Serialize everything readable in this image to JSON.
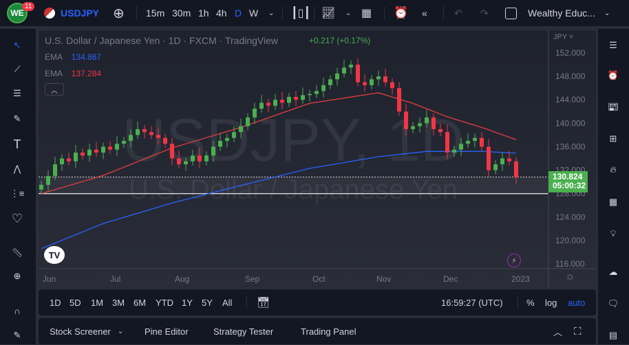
{
  "topbar": {
    "notifications": "11",
    "symbol": "USDJPY",
    "intervals": [
      "15m",
      "30m",
      "1h",
      "4h",
      "D",
      "W"
    ],
    "active_interval": "D",
    "layout_name": "Wealthy Educ..."
  },
  "legend": {
    "title": "U.S. Dollar / Japanese Yen · 1D · FXCM · TradingView",
    "change": "+0.217 (+0.17%)",
    "ema1_label": "EMA",
    "ema1_value": "134.867",
    "ema2_label": "EMA",
    "ema2_value": "137.284"
  },
  "watermark": {
    "line1": "USDJPY, 1D",
    "line2": "U.S. Dollar / Japanese Yen"
  },
  "price_axis": {
    "currency": "JPY",
    "ticks": [
      "152.000",
      "148.000",
      "144.000",
      "140.000",
      "136.000",
      "132.000",
      "128.000",
      "124.000",
      "120.000",
      "116.000"
    ],
    "last_price": "130.824",
    "countdown": "05:00:32"
  },
  "time_axis": {
    "labels": [
      "Jun",
      "Jul",
      "Aug",
      "Sep",
      "Oct",
      "Nov",
      "Dec",
      "2023"
    ]
  },
  "bottombar": {
    "ranges": [
      "1D",
      "5D",
      "1M",
      "3M",
      "6M",
      "YTD",
      "1Y",
      "5Y",
      "All"
    ],
    "time": "16:59:27 (UTC)",
    "pct": "%",
    "log": "log",
    "auto": "auto"
  },
  "panel": {
    "tabs": [
      "Stock Screener",
      "Pine Editor",
      "Strategy Tester",
      "Trading Panel"
    ]
  },
  "colors": {
    "up": "#4caf50",
    "down": "#f23645",
    "ema_fast": "#e53e3e",
    "ema_slow": "#2962ff",
    "accent": "#2962ff"
  },
  "chart_data": {
    "type": "candlestick",
    "ylim": [
      114,
      154
    ],
    "closes": [
      129.5,
      131,
      133,
      134,
      133.5,
      135,
      134.5,
      135.5,
      135,
      136,
      135.5,
      136.5,
      137,
      138,
      139,
      138.5,
      138,
      137.5,
      136.5,
      134,
      133,
      133.5,
      134.5,
      133.5,
      134.5,
      136,
      137,
      137.5,
      138.5,
      139.5,
      141,
      142.5,
      143.5,
      143,
      144,
      143.5,
      144.5,
      144,
      144.8,
      145,
      145.5,
      146.5,
      147.5,
      148.5,
      149.5,
      150,
      147,
      146.5,
      147.5,
      148,
      147,
      146,
      142,
      139,
      139.5,
      140,
      141,
      139,
      138.5,
      135,
      135.5,
      136.5,
      137,
      137.5,
      136,
      132,
      133,
      134,
      133.5,
      130.8
    ],
    "ema_red": [
      [
        0,
        128
      ],
      [
        9,
        131.1
      ],
      [
        19,
        135.8
      ],
      [
        29,
        139.3
      ],
      [
        39,
        143.4
      ],
      [
        49,
        145.2
      ],
      [
        54,
        143.4
      ],
      [
        59,
        141.1
      ],
      [
        64,
        139.3
      ],
      [
        69,
        137.2
      ]
    ],
    "ema_blue": [
      [
        0,
        118.6
      ],
      [
        9,
        122.9
      ],
      [
        19,
        126.4
      ],
      [
        29,
        129.4
      ],
      [
        39,
        132.3
      ],
      [
        49,
        134.3
      ],
      [
        56,
        135.2
      ],
      [
        64,
        135.2
      ],
      [
        69,
        134.9
      ]
    ],
    "hlines": [
      130.824,
      128
    ]
  }
}
